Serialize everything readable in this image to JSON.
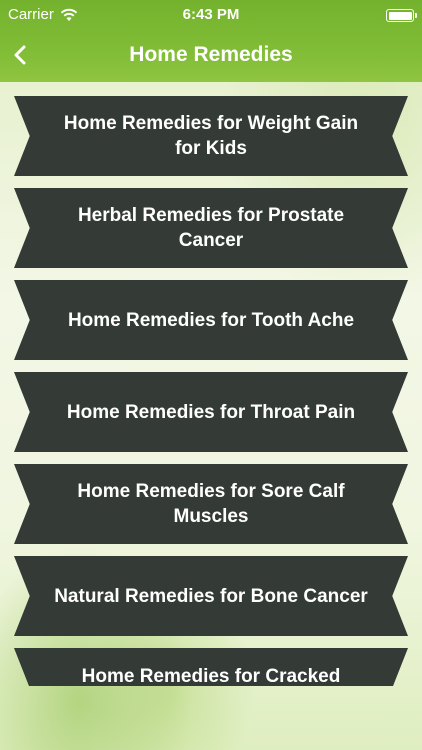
{
  "status_bar": {
    "carrier": "Carrier",
    "time": "6:43 PM"
  },
  "nav": {
    "title": "Home Remedies",
    "back_icon": "chevron-left-icon"
  },
  "items": [
    {
      "label": "Home Remedies for Weight Gain for Kids"
    },
    {
      "label": "Herbal Remedies for Prostate Cancer"
    },
    {
      "label": "Home Remedies for Tooth Ache"
    },
    {
      "label": "Home Remedies for Throat Pain"
    },
    {
      "label": "Home Remedies for Sore Calf Muscles"
    },
    {
      "label": "Natural Remedies for Bone Cancer"
    },
    {
      "label": "Home Remedies for Cracked"
    }
  ],
  "colors": {
    "header": "#80bc35",
    "ribbon": "#343a36",
    "text": "#ffffff"
  }
}
